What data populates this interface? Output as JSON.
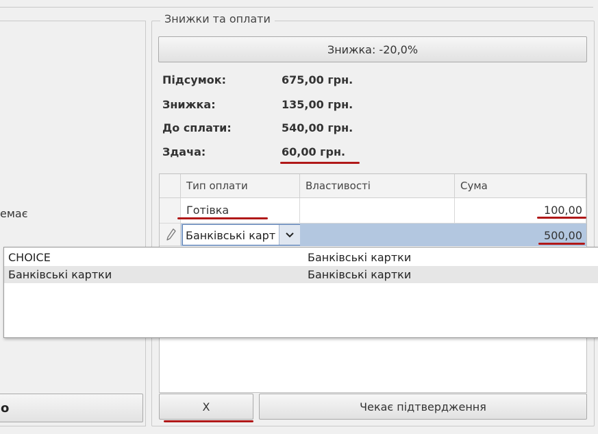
{
  "left_panel": {
    "partial_text": "емає",
    "partial_button": "о"
  },
  "payments_group": {
    "title": "Знижки та оплати",
    "discount_button": "Знижка: -20,0%",
    "summary": [
      {
        "label": "Підсумок:",
        "value": "675,00 грн."
      },
      {
        "label": "Знижка:",
        "value": "135,00 грн."
      },
      {
        "label": "До сплати:",
        "value": "540,00 грн."
      },
      {
        "label": "Здача:",
        "value": "60,00 грн."
      }
    ],
    "table": {
      "headers": [
        "Тип оплати",
        "Властивості",
        "Сума"
      ],
      "rows": [
        {
          "type": "Готівка",
          "properties": "",
          "amount": "100,00"
        },
        {
          "type": "Банківські карт",
          "properties": "",
          "amount": "500,00"
        }
      ]
    },
    "dropdown": {
      "options": [
        {
          "name": "CHOICE",
          "detail": "Банківські картки"
        },
        {
          "name": "Банківські картки",
          "detail": "Банківські картки"
        }
      ]
    },
    "cancel_button": "Х",
    "confirm_button": "Чекає підтвердження"
  },
  "colors": {
    "accent_underline": "#b01818",
    "selected_row": "#b3c7e0",
    "combo_border": "#5b7fb4"
  },
  "icons": {
    "row_edit": "pencil-icon",
    "combo_arrow": "chevron-down-icon"
  }
}
